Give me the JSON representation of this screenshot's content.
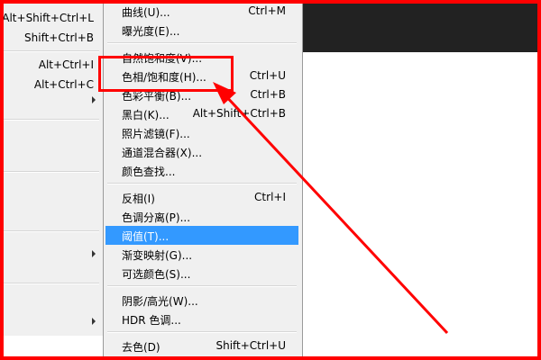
{
  "left_menu": {
    "items": [
      {
        "label": "Alt+Shift+Ctrl+L"
      },
      {
        "label": "Shift+Ctrl+B"
      },
      {
        "label": "Alt+Ctrl+I"
      },
      {
        "label": "Alt+Ctrl+C"
      }
    ]
  },
  "menu": {
    "items": [
      {
        "label": "曲线(U)...",
        "shortcut": "Ctrl+M"
      },
      {
        "label": "曝光度(E)...",
        "shortcut": ""
      },
      {
        "label": "自然饱和度(V)...",
        "shortcut": ""
      },
      {
        "label": "色相/饱和度(H)...",
        "shortcut": "Ctrl+U"
      },
      {
        "label": "色彩平衡(B)...",
        "shortcut": "Ctrl+B"
      },
      {
        "label": "黑白(K)...",
        "shortcut": "Alt+Shift+Ctrl+B"
      },
      {
        "label": "照片滤镜(F)...",
        "shortcut": ""
      },
      {
        "label": "通道混合器(X)...",
        "shortcut": ""
      },
      {
        "label": "颜色查找...",
        "shortcut": ""
      },
      {
        "label": "反相(I)",
        "shortcut": "Ctrl+I"
      },
      {
        "label": "色调分离(P)...",
        "shortcut": ""
      },
      {
        "label": "阈值(T)...",
        "shortcut": ""
      },
      {
        "label": "渐变映射(G)...",
        "shortcut": ""
      },
      {
        "label": "可选颜色(S)...",
        "shortcut": ""
      },
      {
        "label": "阴影/高光(W)...",
        "shortcut": ""
      },
      {
        "label": "HDR 色调...",
        "shortcut": ""
      },
      {
        "label": "去色(D)",
        "shortcut": "Shift+Ctrl+U"
      }
    ],
    "highlighted_index": 11
  },
  "colors": {
    "annotation": "#ff0000",
    "highlight": "#3399ff",
    "menu_bg": "#f0f0f0",
    "canvas_dark": "#222222"
  }
}
